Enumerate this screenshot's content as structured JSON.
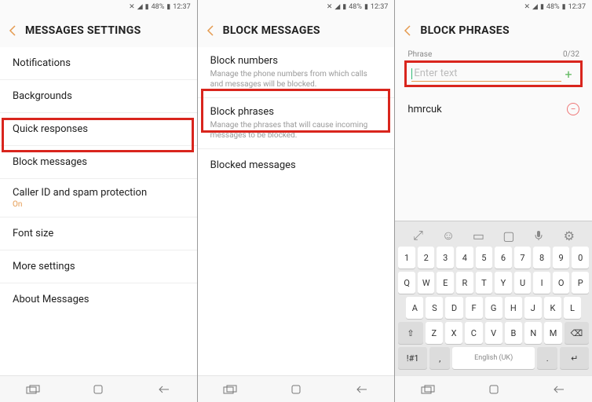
{
  "status": {
    "battery": "48%",
    "time": "12:37"
  },
  "screen1": {
    "title": "MESSAGES SETTINGS",
    "rows": {
      "notifications": "Notifications",
      "backgrounds": "Backgrounds",
      "quick": "Quick responses",
      "block": "Block messages",
      "caller": "Caller ID and spam protection",
      "caller_status": "On",
      "font": "Font size",
      "more": "More settings",
      "about": "About Messages"
    }
  },
  "screen2": {
    "title": "BLOCK MESSAGES",
    "rows": {
      "numbers": "Block numbers",
      "numbers_sub": "Manage the phone numbers from which calls and messages will be blocked.",
      "phrases": "Block phrases",
      "phrases_sub": "Manage the phrases that will cause incoming messages to be blocked.",
      "blocked": "Blocked messages"
    }
  },
  "screen3": {
    "title": "BLOCK PHRASES",
    "phrase_label": "Phrase",
    "counter": "0/32",
    "placeholder": "Enter text",
    "item": "hmrcuk",
    "keyboard": {
      "num": [
        "1",
        "2",
        "3",
        "4",
        "5",
        "6",
        "7",
        "8",
        "9",
        "0"
      ],
      "r1": [
        "Q",
        "W",
        "E",
        "R",
        "T",
        "Y",
        "U",
        "I",
        "O",
        "P"
      ],
      "r2": [
        "A",
        "S",
        "D",
        "F",
        "G",
        "H",
        "J",
        "K",
        "L"
      ],
      "r3": [
        "Z",
        "X",
        "C",
        "V",
        "B",
        "N",
        "M"
      ],
      "sym": "!#1",
      "comma": ",",
      "lang": "English (UK)",
      "dot": "."
    }
  }
}
